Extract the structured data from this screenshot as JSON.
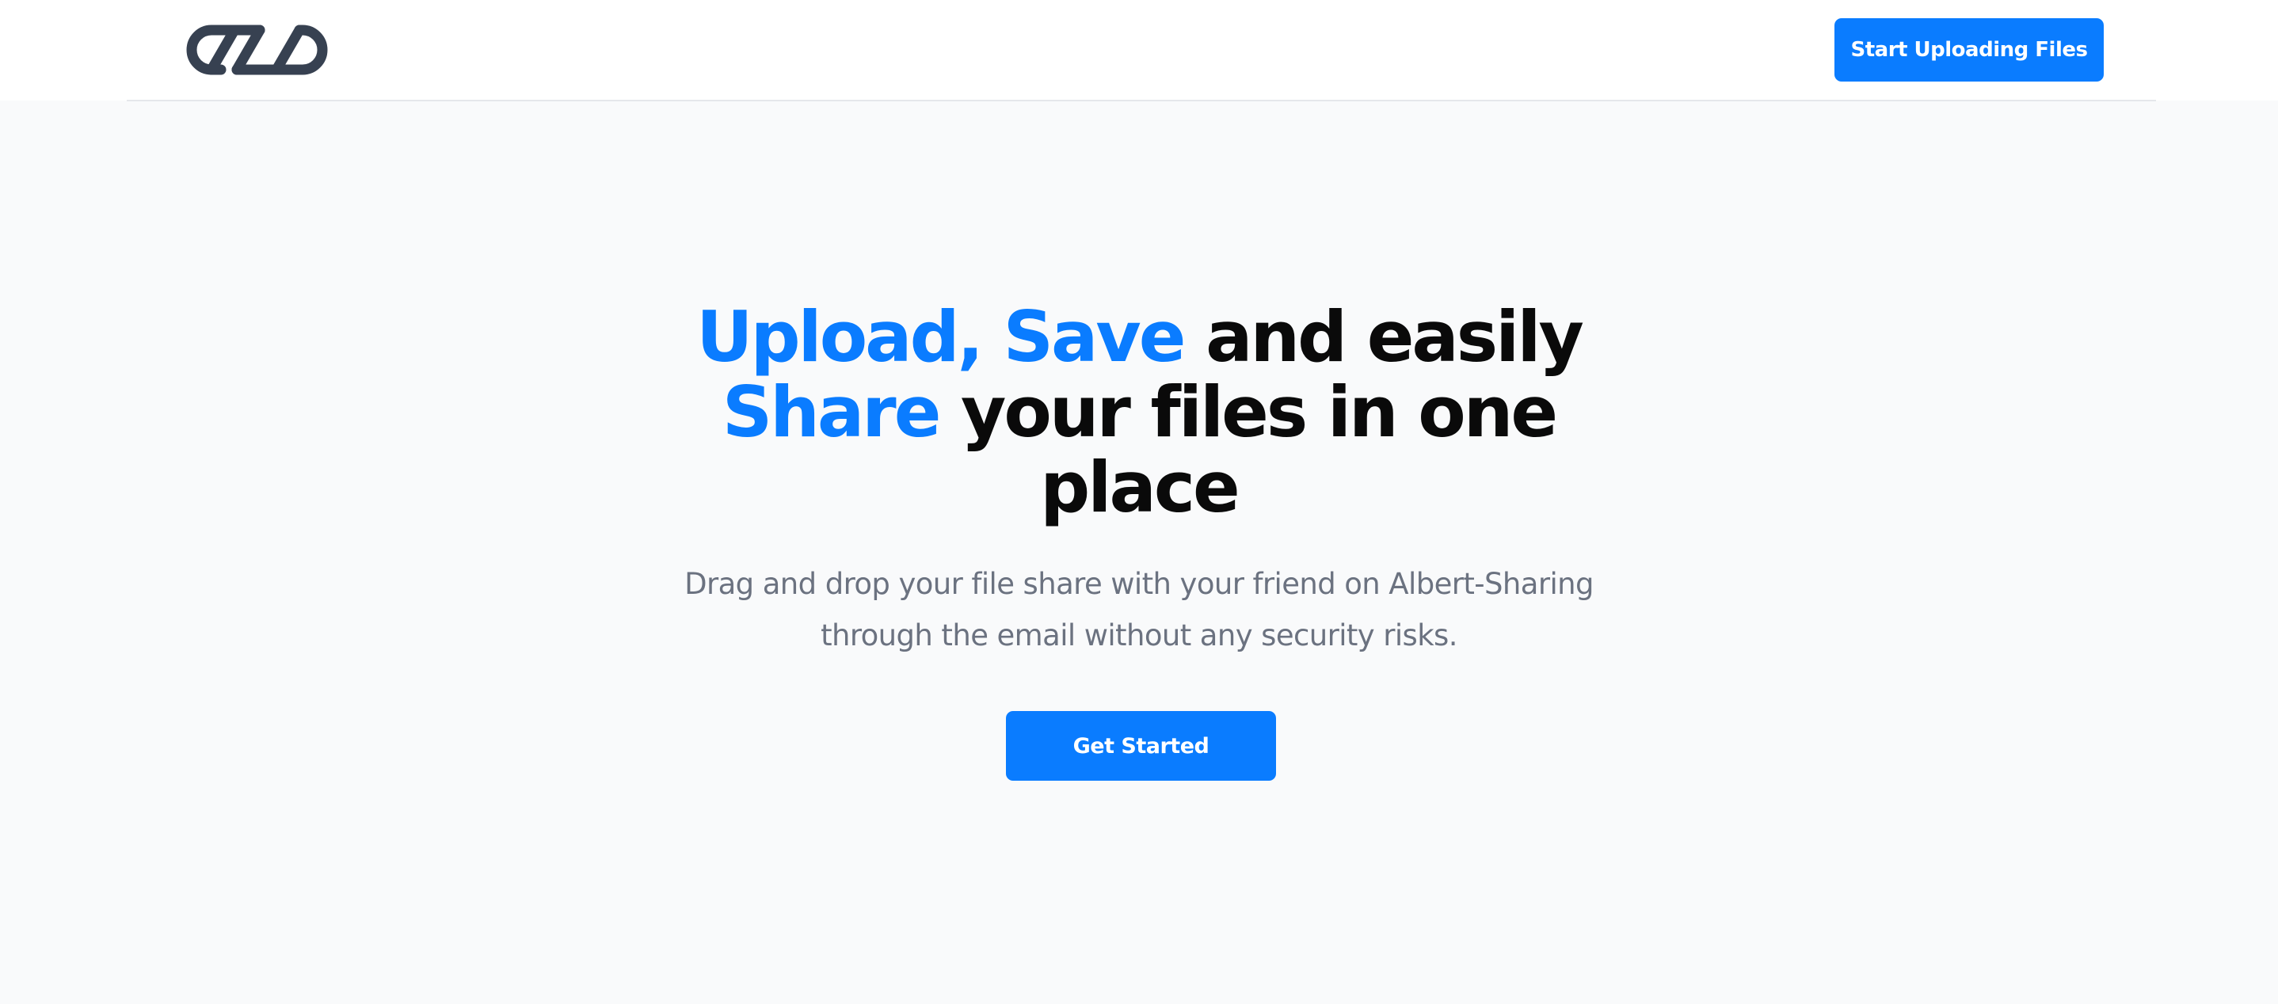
{
  "header": {
    "logo_icon": "chain-link-logo-icon",
    "logo_color": "#374151",
    "upload_button_label": "Start Uploading Files"
  },
  "hero": {
    "title": {
      "part1_accent": "Upload, Save",
      "part2": " and easily ",
      "part3_accent": "Share",
      "part4": " your files in one place"
    },
    "subtitle": "Drag and drop your file share with your friend on Albert-Sharing through the email without any security risks.",
    "cta_label": "Get Started"
  },
  "colors": {
    "accent": "#0a7cff",
    "heading": "#0a0a0a",
    "body_text": "#6b7280",
    "page_background": "#f9fafb",
    "header_background": "#ffffff"
  }
}
